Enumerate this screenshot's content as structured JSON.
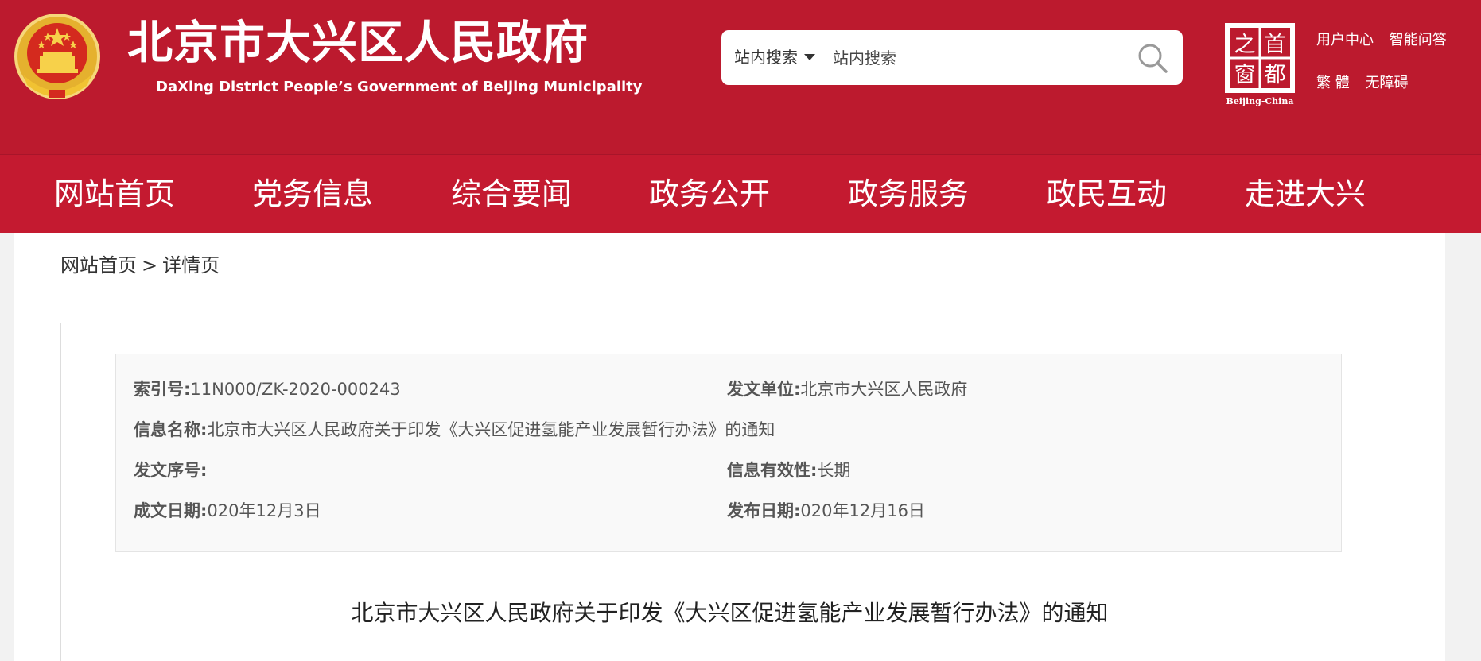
{
  "header": {
    "site_title": "北京市大兴区人民政府",
    "site_subtitle": "DaXing District People’s Government of Beijing Municipality",
    "search": {
      "scope_label": "站内搜索",
      "placeholder": "站内搜索"
    },
    "capital_badge": {
      "chars": [
        "首",
        "都",
        "之",
        "窗"
      ],
      "caption": "Beijing-China"
    },
    "top_links_row1": [
      "用户中心",
      "智能问答"
    ],
    "top_links_row2": [
      "繁 體",
      "无障碍"
    ],
    "colors": {
      "brand_red": "#bc1a2e",
      "nav_red": "#c41a30",
      "emblem_gold": "#f1c232"
    }
  },
  "nav": {
    "items": [
      "网站首页",
      "党务信息",
      "综合要闻",
      "政务公开",
      "政务服务",
      "政民互动",
      "走进大兴"
    ]
  },
  "breadcrumb": {
    "home": "网站首页",
    "separator": ">",
    "current": "详情页"
  },
  "meta": {
    "index_no": {
      "label": "索引号:",
      "value": "11N000/ZK-2020-000243"
    },
    "issuer": {
      "label": "发文单位:",
      "value": "北京市大兴区人民政府"
    },
    "info_name": {
      "label": "信息名称:",
      "value": "北京市大兴区人民政府关于印发《大兴区促进氢能产业发展暂行办法》的通知"
    },
    "doc_no": {
      "label": "发文序号:",
      "value": ""
    },
    "validity": {
      "label": "信息有效性:",
      "value": "长期"
    },
    "written_date": {
      "label": "成文日期:",
      "value": "020年12月3日"
    },
    "publish_date": {
      "label": "发布日期:",
      "value": "020年12月16日"
    }
  },
  "article": {
    "title": "北京市大兴区人民政府关于印发《大兴区促进氢能产业发展暂行办法》的通知"
  }
}
